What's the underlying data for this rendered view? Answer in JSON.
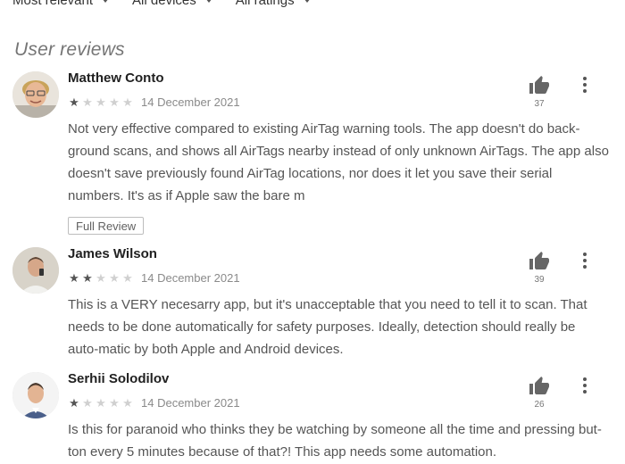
{
  "filters": [
    {
      "label": "Most relevant"
    },
    {
      "label": "All devices"
    },
    {
      "label": "All ratings"
    }
  ],
  "section_title": "User reviews",
  "reviews": [
    {
      "author": "Matthew Conto",
      "rating": 1,
      "date": "14 December 2021",
      "likes": "37",
      "text": "Not very effective compared to existing AirTag warning tools. The app doesn't do back-ground scans, and shows all AirTags nearby instead of only unknown AirTags. The app also doesn't save previously found AirTag locations, nor does it let you save their serial numbers. It's as if Apple saw the bare m",
      "full_review_label": "Full Review"
    },
    {
      "author": "James Wilson",
      "rating": 2,
      "date": "14 December 2021",
      "likes": "39",
      "text": "This is a VERY necesarry app, but it's unacceptable that you need to tell it to scan. That needs to be done automatically for safety purposes. Ideally, detection should really be auto-matic by both Apple and Android devices."
    },
    {
      "author": "Serhii Solodilov",
      "rating": 1,
      "date": "14 December 2021",
      "likes": "26",
      "text": "Is this for paranoid who thinks they be watching by someone all the time and pressing but-ton every 5 minutes because of that?! This app needs some automation."
    }
  ],
  "icons": {
    "like": "thumbs-up-icon",
    "more": "more-vert-icon",
    "filter_caret": "chevron-down-icon"
  },
  "colors": {
    "star_on": "#555555",
    "star_off": "#d0d0d0",
    "section_title": "#757575"
  }
}
